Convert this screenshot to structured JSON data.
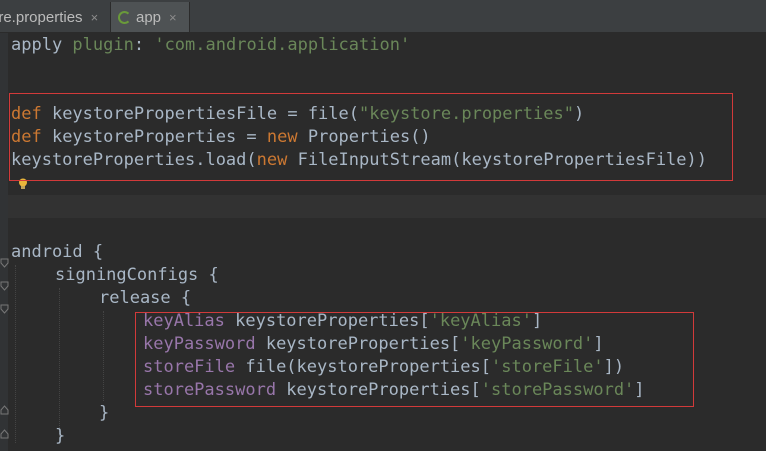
{
  "tabs": [
    {
      "label": "ore.properties",
      "close": "×"
    },
    {
      "label": "app",
      "close": "×"
    }
  ],
  "code": {
    "l1": {
      "a": "apply ",
      "b": "plugin",
      "c": ": ",
      "d": "'com.android.application'"
    },
    "l4": {
      "a": "def ",
      "b": "keystorePropertiesFile = file(",
      "c": "\"keystore.properties\"",
      "d": ")"
    },
    "l5": {
      "a": "def ",
      "b": "keystoreProperties = ",
      "c": "new ",
      "d": "Properties()"
    },
    "l6": {
      "a": "keystoreProperties.load(",
      "b": "new ",
      "c": "FileInputStream(keystorePropertiesFile))"
    },
    "l10": "android {",
    "l11": "signingConfigs {",
    "l12": "release {",
    "l13": {
      "a": "keyAlias ",
      "b": "keystoreProperties[",
      "c": "'keyAlias'",
      "d": "]"
    },
    "l14": {
      "a": "keyPassword ",
      "b": "keystoreProperties[",
      "c": "'keyPassword'",
      "d": "]"
    },
    "l15": {
      "a": "storeFile ",
      "b": "file(keystoreProperties[",
      "c": "'storeFile'",
      "d": "])"
    },
    "l16": {
      "a": "storePassword ",
      "b": "keystoreProperties[",
      "c": "'storePassword'",
      "d": "]"
    },
    "l17": "}",
    "l18": "}"
  },
  "colors": {
    "background": "#2b2b2b",
    "keyword": "#cc7832",
    "string": "#6a8759",
    "field": "#9876aa",
    "text": "#a9b7c6",
    "highlight_box": "#d23a3a"
  }
}
